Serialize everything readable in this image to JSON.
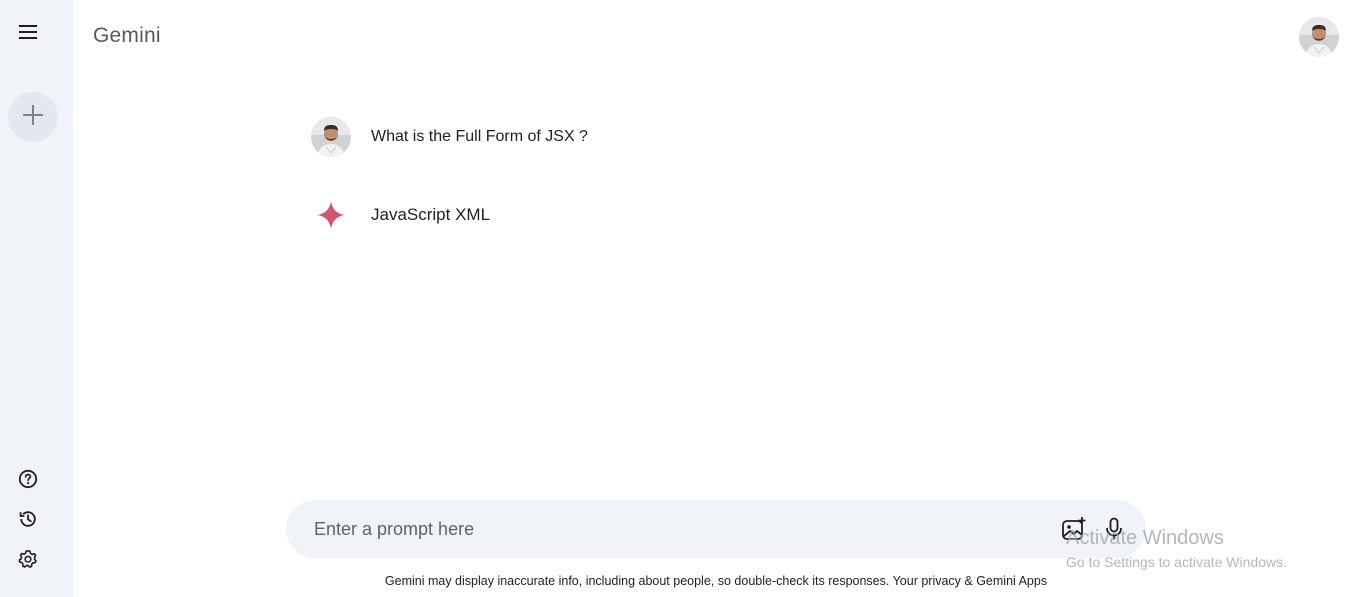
{
  "app": {
    "title": "Gemini"
  },
  "sidebar": {
    "menu_icon": "menu-icon",
    "new_chat_icon": "plus-icon",
    "bottom_icons": [
      "help-icon",
      "history-icon",
      "settings-icon"
    ]
  },
  "conversation": {
    "user_message": "What is the Full Form of JSX ?",
    "assistant_message": "JavaScript XML"
  },
  "prompt": {
    "placeholder": "Enter a prompt here",
    "value": "",
    "icons": [
      "add-image-icon",
      "mic-icon"
    ]
  },
  "footer": {
    "disclaimer": "Gemini may display inaccurate info, including about people, so double-check its responses. Your privacy & Gemini Apps"
  },
  "watermark": {
    "title": "Activate Windows",
    "subtitle": "Go to Settings to activate Windows."
  },
  "colors": {
    "sidebar_bg": "#f0f4f9",
    "prompt_bg": "#f0f4f9",
    "gemini_star": "#d2546f"
  }
}
